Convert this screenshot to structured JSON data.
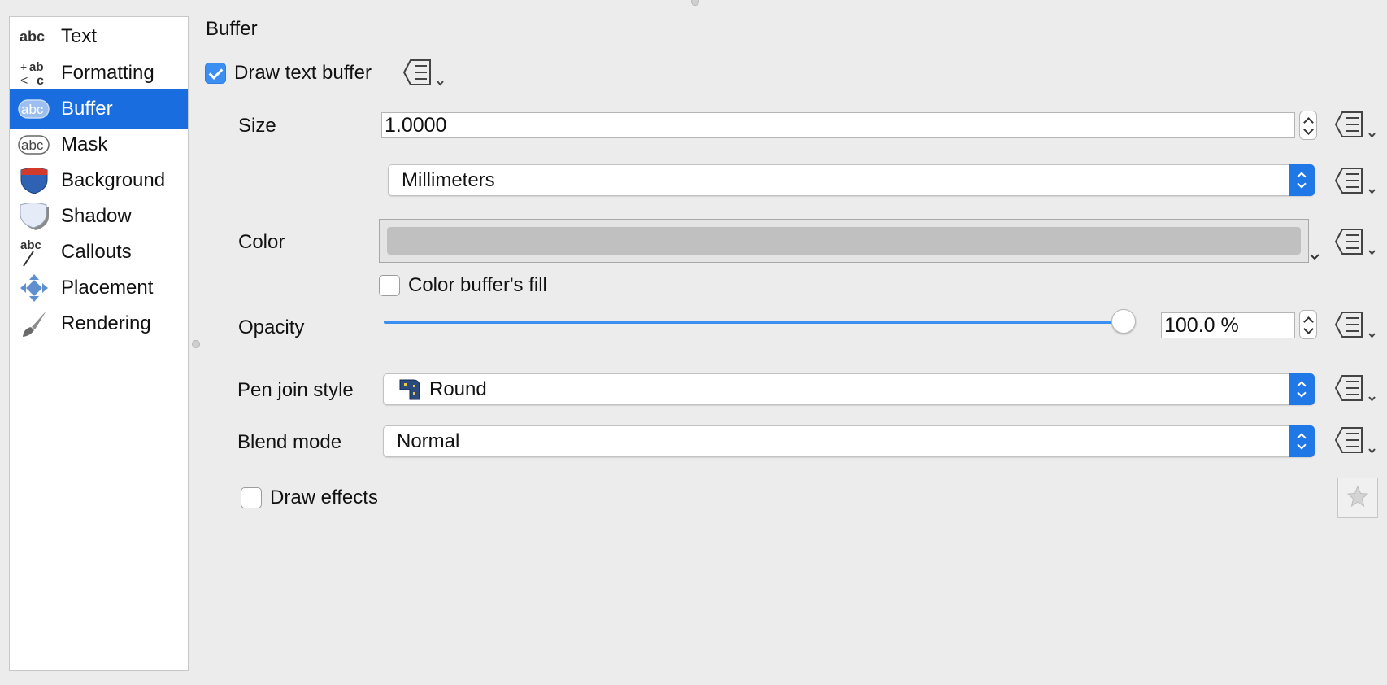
{
  "sidebar": {
    "items": [
      {
        "label": "Text",
        "icon": "text-abc-icon",
        "selected": false
      },
      {
        "label": "Formatting",
        "icon": "formatting-icon",
        "selected": false
      },
      {
        "label": "Buffer",
        "icon": "buffer-abc-icon",
        "selected": true
      },
      {
        "label": "Mask",
        "icon": "mask-abc-icon",
        "selected": false
      },
      {
        "label": "Background",
        "icon": "background-shield-icon",
        "selected": false
      },
      {
        "label": "Shadow",
        "icon": "shadow-shield-icon",
        "selected": false
      },
      {
        "label": "Callouts",
        "icon": "callouts-icon",
        "selected": false
      },
      {
        "label": "Placement",
        "icon": "placement-arrows-icon",
        "selected": false
      },
      {
        "label": "Rendering",
        "icon": "rendering-brush-icon",
        "selected": false
      }
    ]
  },
  "panel": {
    "title": "Buffer",
    "draw_buffer": {
      "label": "Draw text buffer",
      "checked": true
    },
    "size": {
      "label": "Size",
      "value": "1.0000"
    },
    "units": {
      "value": "Millimeters"
    },
    "color": {
      "label": "Color",
      "swatch": "#c0c0c0"
    },
    "color_fill": {
      "label": "Color buffer's fill",
      "checked": false
    },
    "opacity": {
      "label": "Opacity",
      "value": "100.0 %",
      "level_percent": 100
    },
    "pen_join": {
      "label": "Pen join style",
      "value": "Round"
    },
    "blend": {
      "label": "Blend mode",
      "value": "Normal"
    },
    "draw_effects": {
      "label": "Draw effects",
      "checked": false
    }
  },
  "colors": {
    "accent": "#1a6dde",
    "checkbox": "#3b8ff3"
  }
}
